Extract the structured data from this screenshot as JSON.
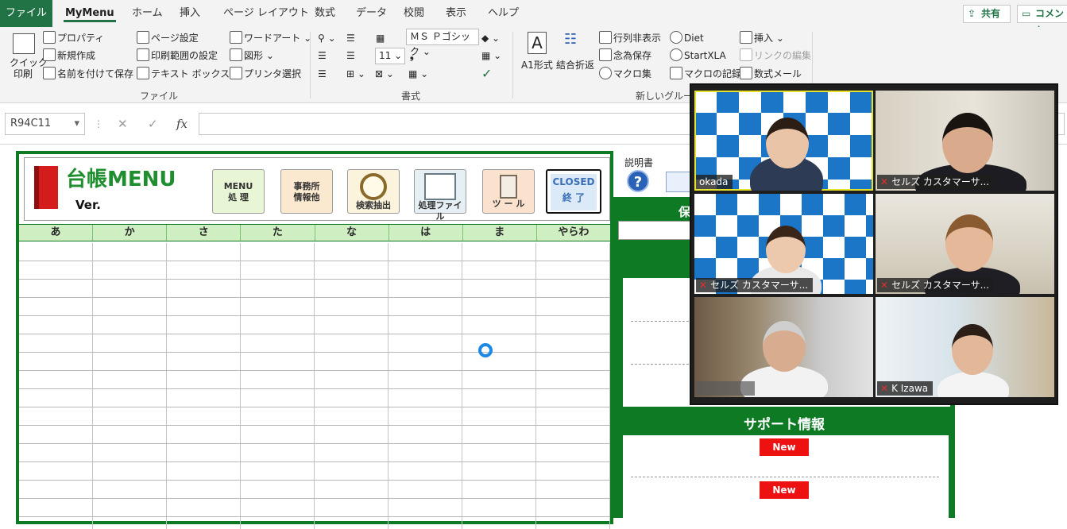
{
  "tabs": [
    "ファイル",
    "MyMenu",
    "ホーム",
    "挿入",
    "ページ レイアウト",
    "数式",
    "データ",
    "校閲",
    "表示",
    "ヘルプ"
  ],
  "active_tab": "MyMenu",
  "top_buttons": {
    "share": "共有",
    "comment": "コメント"
  },
  "ribbon": {
    "quick_print": "クイック\n印刷",
    "properties": "プロパティ",
    "new_file": "新規作成",
    "save_as": "名前を付けて保存",
    "page_setup": "ページ設定",
    "print_area": "印刷範囲の設定",
    "text_box": "テキスト ボックス",
    "wordart": "ワードアート",
    "shapes": "図形",
    "printer_select": "プリンタ選択",
    "group_file": "ファイル",
    "font_name": "ＭＳ Ｐゴシック",
    "font_size": "11",
    "group_format": "書式",
    "a1_style": "A1形式",
    "wrap_text": "結合折返",
    "row_col_hide": "行列非表示",
    "emergency_save": "念為保存",
    "macro_collection": "マクロ集",
    "diet": "Diet",
    "startxla": "StartXLA",
    "macro_record": "マクロの記録",
    "insert": "挿入",
    "link_edit": "リンクの編集",
    "formula_mail": "数式メール",
    "group_new": "新しいグループ"
  },
  "formula_bar": {
    "name_box": "R94C11",
    "fx": "fx"
  },
  "menu": {
    "title": "台帳MENU",
    "version": "Ver.",
    "buttons": [
      {
        "label": "MENU\n処 理"
      },
      {
        "label": "事務所\n情報他"
      },
      {
        "label": "検索抽出"
      },
      {
        "label": "処理ファイル"
      },
      {
        "label": "ツ ー ル"
      },
      {
        "label": "CLOSED\n終 了"
      }
    ],
    "kana_headers": [
      "あ",
      "か",
      "さ",
      "た",
      "な",
      "は",
      "ま",
      "やらわ"
    ]
  },
  "side": {
    "manual": "説明書",
    "save_label": "保",
    "support_title": "サポート情報",
    "new_badges": [
      "New",
      "New"
    ]
  },
  "video_call": {
    "participants": [
      {
        "name": "okada",
        "muted": false
      },
      {
        "name": "セルズ カスタマーサ...",
        "muted": true
      },
      {
        "name": "セルズ カスタマーサ...",
        "muted": true
      },
      {
        "name": "セルズ カスタマーサ...",
        "muted": true
      },
      {
        "name": "",
        "muted": false
      },
      {
        "name": "K Izawa",
        "muted": true
      }
    ]
  },
  "colors": {
    "excel_green": "#217346",
    "menu_green": "#0e7a24",
    "new_red": "#ee1111",
    "check_blue": "#1c76c8"
  }
}
